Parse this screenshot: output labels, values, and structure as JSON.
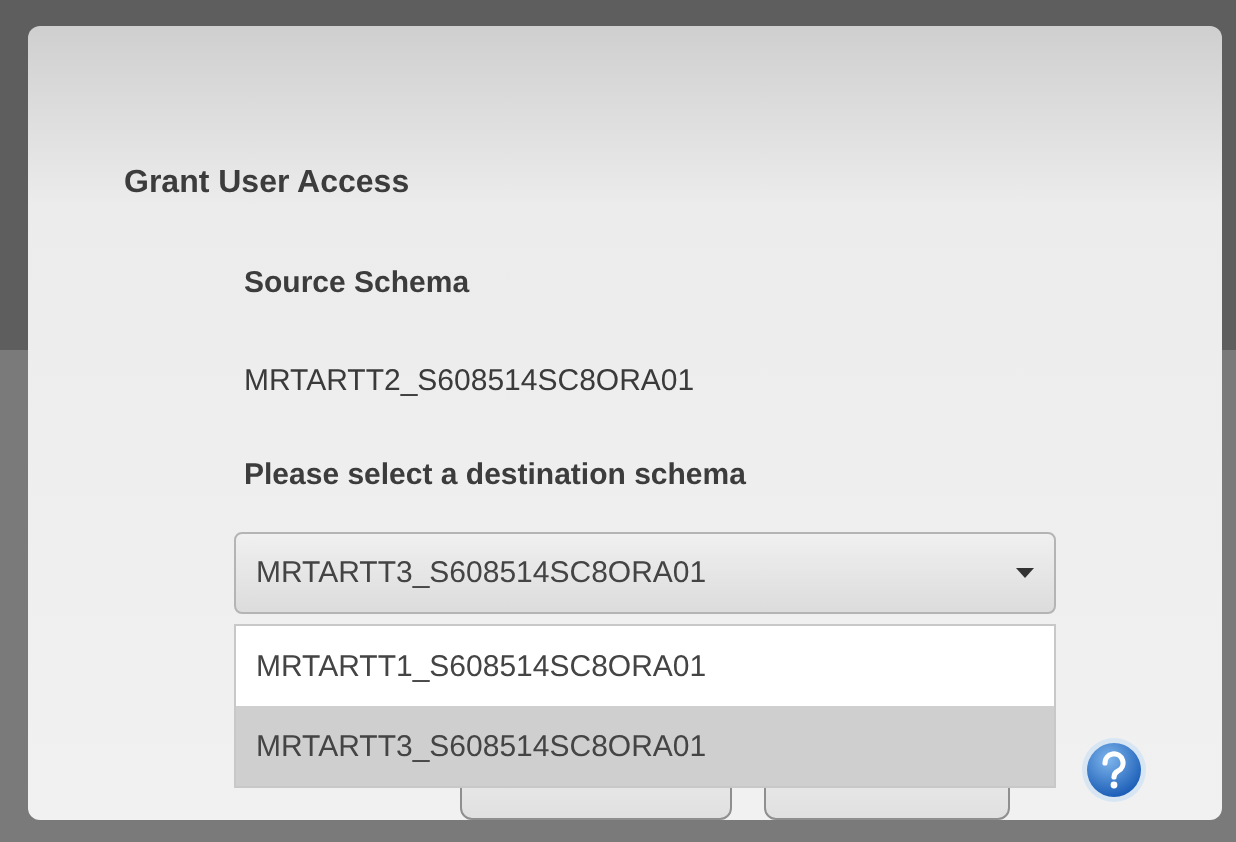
{
  "dialog": {
    "title": "Grant User Access",
    "source_label": "Source Schema",
    "source_value": "MRTARTT2_S608514SC8ORA01",
    "destination_label": "Please select a destination schema",
    "destination_select": {
      "value": "MRTARTT3_S608514SC8ORA01",
      "expanded": true,
      "options": [
        {
          "label": "MRTARTT1_S608514SC8ORA01",
          "selected": false
        },
        {
          "label": "MRTARTT3_S608514SC8ORA01",
          "selected": true
        }
      ]
    }
  }
}
